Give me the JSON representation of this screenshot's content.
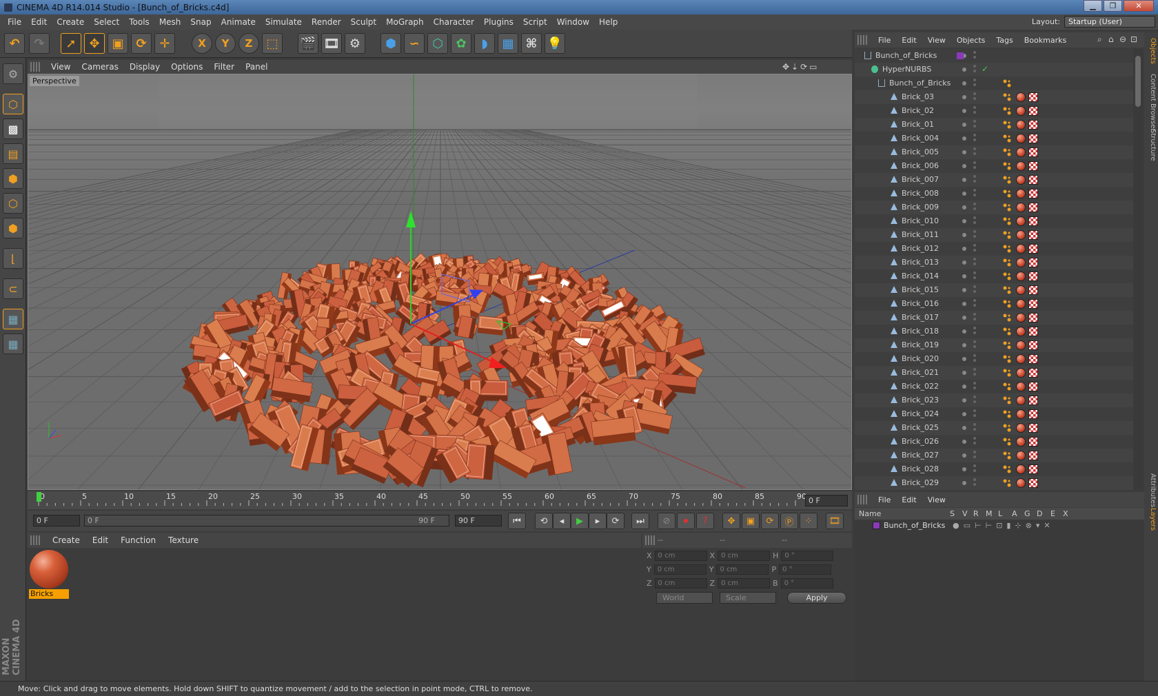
{
  "window": {
    "title": "CINEMA 4D R14.014 Studio - [Bunch_of_Bricks.c4d]"
  },
  "menubar": [
    "File",
    "Edit",
    "Create",
    "Select",
    "Tools",
    "Mesh",
    "Snap",
    "Animate",
    "Simulate",
    "Render",
    "Sculpt",
    "MoGraph",
    "Character",
    "Plugins",
    "Script",
    "Window",
    "Help"
  ],
  "layout": {
    "label": "Layout:",
    "value": "Startup (User)"
  },
  "viewport": {
    "menu": [
      "View",
      "Cameras",
      "Display",
      "Options",
      "Filter",
      "Panel"
    ],
    "label": "Perspective"
  },
  "timeline": {
    "ticks": [
      "0",
      "5",
      "10",
      "15",
      "20",
      "25",
      "30",
      "35",
      "40",
      "45",
      "50",
      "55",
      "60",
      "65",
      "70",
      "75",
      "80",
      "85",
      "90"
    ],
    "current_frame": "0 F"
  },
  "transport": {
    "start": "0 F",
    "range_start": "0 F",
    "range_end": "90 F",
    "end": "90 F"
  },
  "materials": {
    "menu": [
      "Create",
      "Edit",
      "Function",
      "Texture"
    ],
    "items": [
      {
        "name": "Bricks"
      }
    ]
  },
  "coords": {
    "header": [
      "--",
      "--",
      "--"
    ],
    "rows": [
      {
        "a": "X",
        "av": "0 cm",
        "b": "X",
        "bv": "0 cm",
        "c": "H",
        "cv": "0 °"
      },
      {
        "a": "Y",
        "av": "0 cm",
        "b": "Y",
        "bv": "0 cm",
        "c": "P",
        "cv": "0 °"
      },
      {
        "a": "Z",
        "av": "0 cm",
        "b": "Z",
        "bv": "0 cm",
        "c": "B",
        "cv": "0 °"
      }
    ],
    "world": "World",
    "scale": "Scale",
    "apply": "Apply"
  },
  "objects": {
    "menu": [
      "File",
      "Edit",
      "View",
      "Objects",
      "Tags",
      "Bookmarks"
    ],
    "tree": [
      {
        "name": "Bunch_of_Bricks",
        "type": "null",
        "level": 0
      },
      {
        "name": "HyperNURBS",
        "type": "nurbs",
        "level": 1
      },
      {
        "name": "Bunch_of_Bricks",
        "type": "null",
        "level": 2
      },
      {
        "name": "Brick_03",
        "type": "poly",
        "level": 3
      },
      {
        "name": "Brick_02",
        "type": "poly",
        "level": 3
      },
      {
        "name": "Brick_01",
        "type": "poly",
        "level": 3
      },
      {
        "name": "Brick_004",
        "type": "poly",
        "level": 3
      },
      {
        "name": "Brick_005",
        "type": "poly",
        "level": 3
      },
      {
        "name": "Brick_006",
        "type": "poly",
        "level": 3
      },
      {
        "name": "Brick_007",
        "type": "poly",
        "level": 3
      },
      {
        "name": "Brick_008",
        "type": "poly",
        "level": 3
      },
      {
        "name": "Brick_009",
        "type": "poly",
        "level": 3
      },
      {
        "name": "Brick_010",
        "type": "poly",
        "level": 3
      },
      {
        "name": "Brick_011",
        "type": "poly",
        "level": 3
      },
      {
        "name": "Brick_012",
        "type": "poly",
        "level": 3
      },
      {
        "name": "Brick_013",
        "type": "poly",
        "level": 3
      },
      {
        "name": "Brick_014",
        "type": "poly",
        "level": 3
      },
      {
        "name": "Brick_015",
        "type": "poly",
        "level": 3
      },
      {
        "name": "Brick_016",
        "type": "poly",
        "level": 3
      },
      {
        "name": "Brick_017",
        "type": "poly",
        "level": 3
      },
      {
        "name": "Brick_018",
        "type": "poly",
        "level": 3
      },
      {
        "name": "Brick_019",
        "type": "poly",
        "level": 3
      },
      {
        "name": "Brick_020",
        "type": "poly",
        "level": 3
      },
      {
        "name": "Brick_021",
        "type": "poly",
        "level": 3
      },
      {
        "name": "Brick_022",
        "type": "poly",
        "level": 3
      },
      {
        "name": "Brick_023",
        "type": "poly",
        "level": 3
      },
      {
        "name": "Brick_024",
        "type": "poly",
        "level": 3
      },
      {
        "name": "Brick_025",
        "type": "poly",
        "level": 3
      },
      {
        "name": "Brick_026",
        "type": "poly",
        "level": 3
      },
      {
        "name": "Brick_027",
        "type": "poly",
        "level": 3
      },
      {
        "name": "Brick_028",
        "type": "poly",
        "level": 3
      },
      {
        "name": "Brick_029",
        "type": "poly",
        "level": 3
      }
    ]
  },
  "side_tabs": [
    "Objects",
    "Content Browser",
    "Structure",
    "Attributes",
    "Layers"
  ],
  "layers": {
    "menu": [
      "File",
      "Edit",
      "View"
    ],
    "columns": [
      "Name",
      "S",
      "V",
      "R",
      "M",
      "L",
      "A",
      "G",
      "D",
      "E",
      "X"
    ],
    "rows": [
      {
        "name": "Bunch_of_Bricks",
        "color": "#8a3ab8"
      }
    ]
  },
  "status": "Move: Click and drag to move elements. Hold down SHIFT to quantize movement / add to the selection in point mode, CTRL to remove.",
  "colors": {
    "accent": "#f0a020",
    "brick": "#d0603e",
    "axis_x": "#e02020",
    "axis_y": "#20c020",
    "axis_z": "#2040e0"
  }
}
